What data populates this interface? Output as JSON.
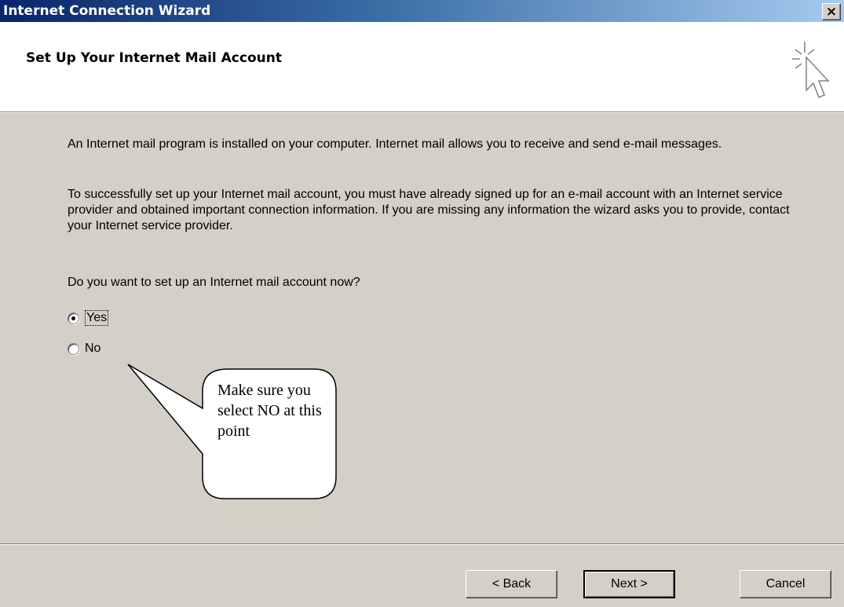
{
  "window": {
    "title": "Internet Connection Wizard",
    "close_label": "×"
  },
  "header": {
    "title": "Set Up Your Internet Mail Account",
    "icon": "wizard-cursor-icon"
  },
  "body": {
    "paragraph1": "An Internet mail program is installed on your computer. Internet mail allows you to receive and send e-mail messages.",
    "paragraph2": "To successfully set up your Internet mail account, you must have already signed up for an e-mail account with an Internet service provider and obtained important connection information. If you are missing any information the wizard asks you to provide, contact your Internet service provider.",
    "question": "Do you want to set up an Internet mail account now?"
  },
  "options": {
    "yes_label": "Yes",
    "no_label": "No",
    "selected": "Yes"
  },
  "callout": {
    "text": "Make sure you select NO at this point"
  },
  "buttons": {
    "back_label": "< Back",
    "next_label": "Next >",
    "cancel_label": "Cancel"
  },
  "colors": {
    "dialog_bg": "#d4d0c8",
    "title_gradient_start": "#0a246a",
    "title_gradient_end": "#a6caf0",
    "header_bg": "#ffffff"
  }
}
